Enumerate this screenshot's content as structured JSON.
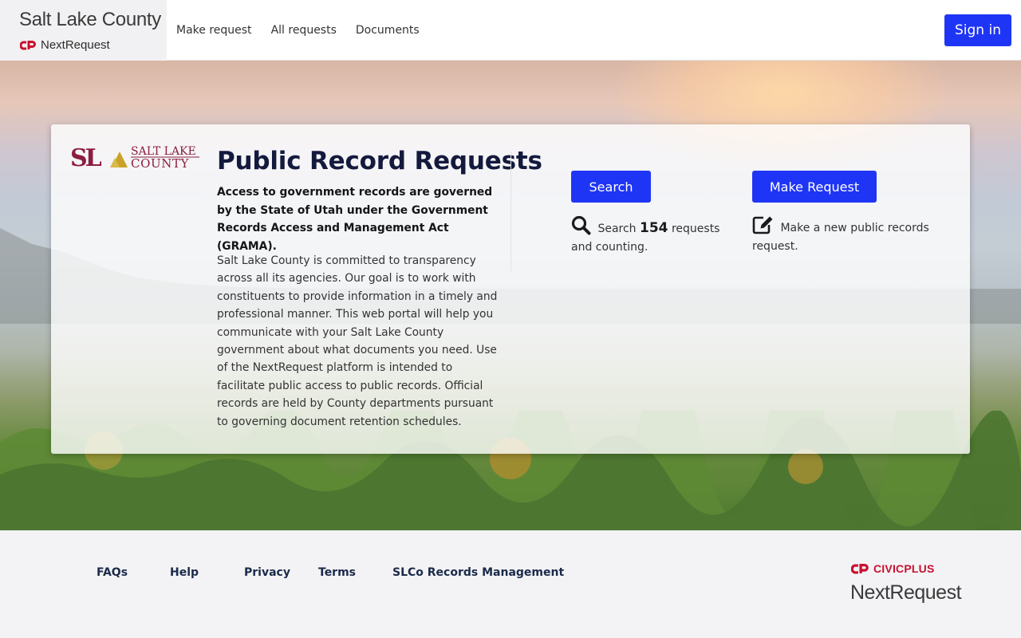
{
  "header": {
    "county": "Salt Lake County",
    "product": "NextRequest",
    "nav": [
      "Make request",
      "All requests",
      "Documents"
    ],
    "signin_label": "Sign in"
  },
  "card": {
    "logo_text_line1": "SALT LAKE",
    "logo_text_line2": "COUNTY",
    "logo_monogram": "SL",
    "title": "Public Record Requests",
    "lead": "Access to government records are governed by the State of Utah under the Government Records Access and Management Act (GRAMA).",
    "body": "Salt Lake County is committed to transparency across all its agencies. Our goal is to work with constituents to provide information in a timely and professional manner. This web portal will help you communicate with your Salt Lake County government about what documents you need. Use of the NextRequest platform is intended to facilitate public access to public records. Official records are held by County departments pursuant to governing document retention schedules.",
    "search_button": "Search",
    "search_prefix": "Search",
    "search_count": "154",
    "search_suffix": "requests and counting.",
    "make_button": "Make Request",
    "make_note": "Make a new public records request."
  },
  "footer": {
    "links": [
      "FAQs",
      "Help",
      "Privacy",
      "Terms",
      "SLCo Records Management"
    ],
    "vendor": "CIVICPLUS",
    "product": "NextRequest"
  },
  "colors": {
    "primary": "#1f35f5",
    "title": "#141a3d",
    "logo_red": "#8b1e3f",
    "logo_gold": "#c9a227",
    "civic_red": "#c8102e"
  },
  "icons": {
    "search": "search-icon",
    "edit": "edit-icon",
    "civicplus": "civicplus-logo-icon"
  }
}
